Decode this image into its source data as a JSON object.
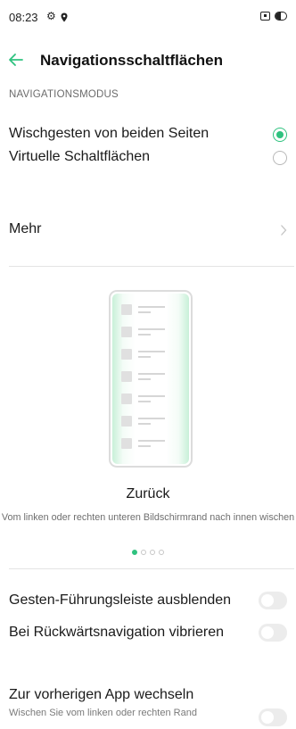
{
  "status_bar": {
    "time": "08:23",
    "icons": [
      "gear-icon",
      "location-icon",
      "screen-record-icon",
      "battery-icon"
    ]
  },
  "header": {
    "back_icon": "arrow-left-icon",
    "title": "Navigationsschaltflächen"
  },
  "section": {
    "label": "NAVIGATIONSMODUS"
  },
  "options": [
    {
      "label": "Wischgesten von beiden Seiten",
      "selected": true
    },
    {
      "label": "Virtuelle Schaltflächen",
      "selected": false
    }
  ],
  "more": {
    "label": "Mehr",
    "icon": "chevron-right-icon"
  },
  "demo": {
    "title": "Zurück",
    "description": "Vom linken oder rechten unteren Bildschirmrand nach innen wischen",
    "pages": 4,
    "active_page": 1
  },
  "toggles": [
    {
      "label": "Gesten-Führungsleiste ausblenden",
      "on": false
    },
    {
      "label": "Bei Rückwärtsnavigation vibrieren",
      "on": false
    },
    {
      "label": "Zur vorherigen App wechseln",
      "sub": "Wischen Sie vom linken oder rechten Rand",
      "on": false
    }
  ],
  "colors": {
    "accent": "#2fc27f",
    "toggle_off": "#ececec"
  }
}
